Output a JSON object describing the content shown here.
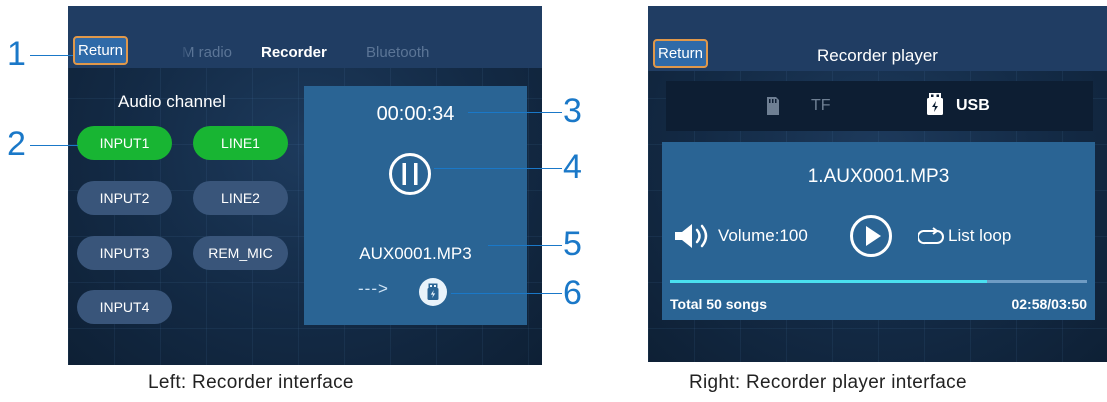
{
  "left_screen": {
    "return_label": "Return",
    "tabs": [
      "M radio",
      "Recorder",
      "Bluetooth"
    ],
    "audio_channel_title": "Audio channel",
    "channels": [
      "INPUT1",
      "LINE1",
      "INPUT2",
      "LINE2",
      "INPUT3",
      "REM_MIC",
      "INPUT4"
    ],
    "timer": "00:00:34",
    "filename": "AUX0001.MP3",
    "arrow": "--->"
  },
  "callouts": [
    "1",
    "2",
    "3",
    "4",
    "5",
    "6"
  ],
  "right_screen": {
    "return_label": "Return",
    "title": "Recorder player",
    "source_tf": "TF",
    "source_usb": "USB",
    "track": "1.AUX0001.MP3",
    "volume": "Volume:100",
    "loop": "List loop",
    "progress": 0.76,
    "total": "Total 50 songs",
    "time": "02:58/03:50"
  },
  "captions": {
    "left": "Left: Recorder interface",
    "right": "Right: Recorder player interface"
  },
  "colors": {
    "accent_green": "#18b533",
    "callout_blue": "#1a78c8",
    "panel_blue": "#2a6494",
    "return_border": "#e0984a"
  }
}
